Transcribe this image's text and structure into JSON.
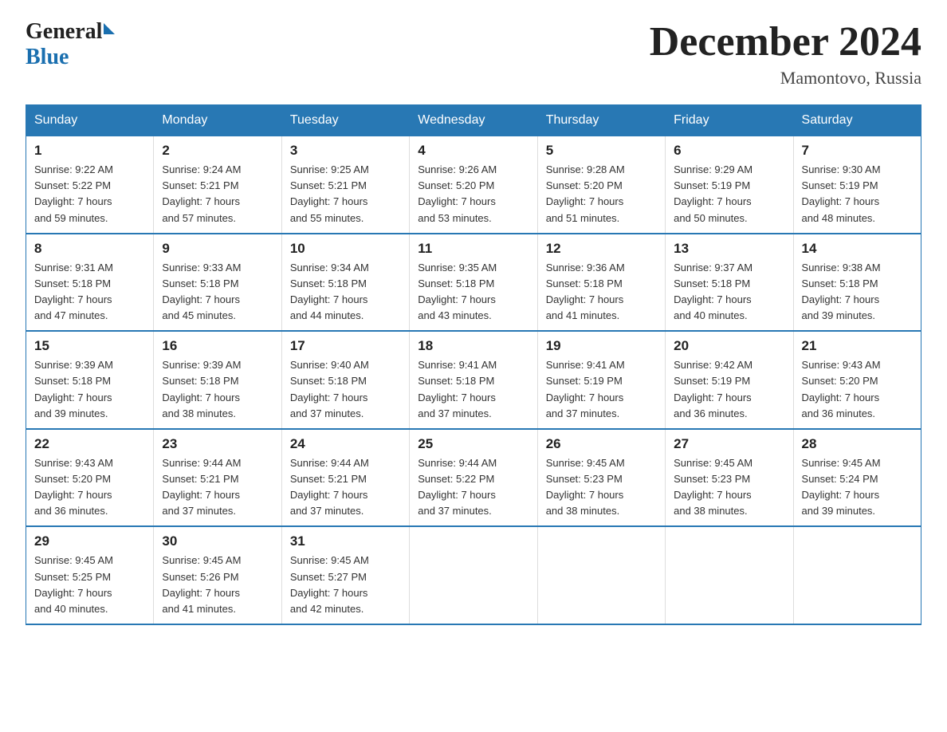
{
  "header": {
    "logo": {
      "general": "General",
      "triangle": "",
      "blue": "Blue"
    },
    "title": "December 2024",
    "location": "Mamontovo, Russia"
  },
  "weekdays": [
    "Sunday",
    "Monday",
    "Tuesday",
    "Wednesday",
    "Thursday",
    "Friday",
    "Saturday"
  ],
  "weeks": [
    [
      {
        "day": "1",
        "sunrise": "9:22 AM",
        "sunset": "5:22 PM",
        "daylight": "7 hours and 59 minutes."
      },
      {
        "day": "2",
        "sunrise": "9:24 AM",
        "sunset": "5:21 PM",
        "daylight": "7 hours and 57 minutes."
      },
      {
        "day": "3",
        "sunrise": "9:25 AM",
        "sunset": "5:21 PM",
        "daylight": "7 hours and 55 minutes."
      },
      {
        "day": "4",
        "sunrise": "9:26 AM",
        "sunset": "5:20 PM",
        "daylight": "7 hours and 53 minutes."
      },
      {
        "day": "5",
        "sunrise": "9:28 AM",
        "sunset": "5:20 PM",
        "daylight": "7 hours and 51 minutes."
      },
      {
        "day": "6",
        "sunrise": "9:29 AM",
        "sunset": "5:19 PM",
        "daylight": "7 hours and 50 minutes."
      },
      {
        "day": "7",
        "sunrise": "9:30 AM",
        "sunset": "5:19 PM",
        "daylight": "7 hours and 48 minutes."
      }
    ],
    [
      {
        "day": "8",
        "sunrise": "9:31 AM",
        "sunset": "5:18 PM",
        "daylight": "7 hours and 47 minutes."
      },
      {
        "day": "9",
        "sunrise": "9:33 AM",
        "sunset": "5:18 PM",
        "daylight": "7 hours and 45 minutes."
      },
      {
        "day": "10",
        "sunrise": "9:34 AM",
        "sunset": "5:18 PM",
        "daylight": "7 hours and 44 minutes."
      },
      {
        "day": "11",
        "sunrise": "9:35 AM",
        "sunset": "5:18 PM",
        "daylight": "7 hours and 43 minutes."
      },
      {
        "day": "12",
        "sunrise": "9:36 AM",
        "sunset": "5:18 PM",
        "daylight": "7 hours and 41 minutes."
      },
      {
        "day": "13",
        "sunrise": "9:37 AM",
        "sunset": "5:18 PM",
        "daylight": "7 hours and 40 minutes."
      },
      {
        "day": "14",
        "sunrise": "9:38 AM",
        "sunset": "5:18 PM",
        "daylight": "7 hours and 39 minutes."
      }
    ],
    [
      {
        "day": "15",
        "sunrise": "9:39 AM",
        "sunset": "5:18 PM",
        "daylight": "7 hours and 39 minutes."
      },
      {
        "day": "16",
        "sunrise": "9:39 AM",
        "sunset": "5:18 PM",
        "daylight": "7 hours and 38 minutes."
      },
      {
        "day": "17",
        "sunrise": "9:40 AM",
        "sunset": "5:18 PM",
        "daylight": "7 hours and 37 minutes."
      },
      {
        "day": "18",
        "sunrise": "9:41 AM",
        "sunset": "5:18 PM",
        "daylight": "7 hours and 37 minutes."
      },
      {
        "day": "19",
        "sunrise": "9:41 AM",
        "sunset": "5:19 PM",
        "daylight": "7 hours and 37 minutes."
      },
      {
        "day": "20",
        "sunrise": "9:42 AM",
        "sunset": "5:19 PM",
        "daylight": "7 hours and 36 minutes."
      },
      {
        "day": "21",
        "sunrise": "9:43 AM",
        "sunset": "5:20 PM",
        "daylight": "7 hours and 36 minutes."
      }
    ],
    [
      {
        "day": "22",
        "sunrise": "9:43 AM",
        "sunset": "5:20 PM",
        "daylight": "7 hours and 36 minutes."
      },
      {
        "day": "23",
        "sunrise": "9:44 AM",
        "sunset": "5:21 PM",
        "daylight": "7 hours and 37 minutes."
      },
      {
        "day": "24",
        "sunrise": "9:44 AM",
        "sunset": "5:21 PM",
        "daylight": "7 hours and 37 minutes."
      },
      {
        "day": "25",
        "sunrise": "9:44 AM",
        "sunset": "5:22 PM",
        "daylight": "7 hours and 37 minutes."
      },
      {
        "day": "26",
        "sunrise": "9:45 AM",
        "sunset": "5:23 PM",
        "daylight": "7 hours and 38 minutes."
      },
      {
        "day": "27",
        "sunrise": "9:45 AM",
        "sunset": "5:23 PM",
        "daylight": "7 hours and 38 minutes."
      },
      {
        "day": "28",
        "sunrise": "9:45 AM",
        "sunset": "5:24 PM",
        "daylight": "7 hours and 39 minutes."
      }
    ],
    [
      {
        "day": "29",
        "sunrise": "9:45 AM",
        "sunset": "5:25 PM",
        "daylight": "7 hours and 40 minutes."
      },
      {
        "day": "30",
        "sunrise": "9:45 AM",
        "sunset": "5:26 PM",
        "daylight": "7 hours and 41 minutes."
      },
      {
        "day": "31",
        "sunrise": "9:45 AM",
        "sunset": "5:27 PM",
        "daylight": "7 hours and 42 minutes."
      },
      null,
      null,
      null,
      null
    ]
  ]
}
